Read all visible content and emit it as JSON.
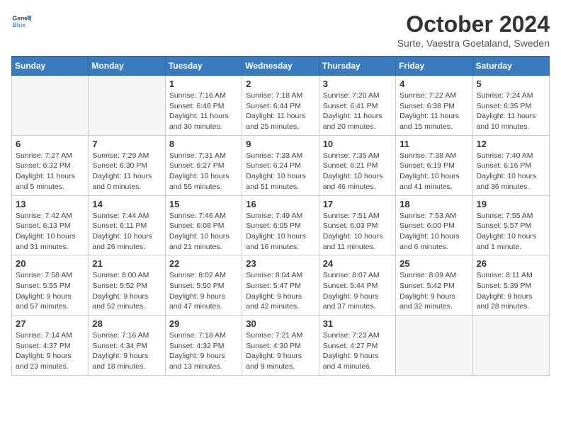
{
  "header": {
    "logo_line1": "General",
    "logo_line2": "Blue",
    "month": "October 2024",
    "location": "Surte, Vaestra Goetaland, Sweden"
  },
  "days_of_week": [
    "Sunday",
    "Monday",
    "Tuesday",
    "Wednesday",
    "Thursday",
    "Friday",
    "Saturday"
  ],
  "weeks": [
    [
      {
        "day": "",
        "info": ""
      },
      {
        "day": "",
        "info": ""
      },
      {
        "day": "1",
        "info": "Sunrise: 7:16 AM\nSunset: 6:46 PM\nDaylight: 11 hours and 30 minutes."
      },
      {
        "day": "2",
        "info": "Sunrise: 7:18 AM\nSunset: 6:44 PM\nDaylight: 11 hours and 25 minutes."
      },
      {
        "day": "3",
        "info": "Sunrise: 7:20 AM\nSunset: 6:41 PM\nDaylight: 11 hours and 20 minutes."
      },
      {
        "day": "4",
        "info": "Sunrise: 7:22 AM\nSunset: 6:38 PM\nDaylight: 11 hours and 15 minutes."
      },
      {
        "day": "5",
        "info": "Sunrise: 7:24 AM\nSunset: 6:35 PM\nDaylight: 11 hours and 10 minutes."
      }
    ],
    [
      {
        "day": "6",
        "info": "Sunrise: 7:27 AM\nSunset: 6:32 PM\nDaylight: 11 hours and 5 minutes."
      },
      {
        "day": "7",
        "info": "Sunrise: 7:29 AM\nSunset: 6:30 PM\nDaylight: 11 hours and 0 minutes."
      },
      {
        "day": "8",
        "info": "Sunrise: 7:31 AM\nSunset: 6:27 PM\nDaylight: 10 hours and 55 minutes."
      },
      {
        "day": "9",
        "info": "Sunrise: 7:33 AM\nSunset: 6:24 PM\nDaylight: 10 hours and 51 minutes."
      },
      {
        "day": "10",
        "info": "Sunrise: 7:35 AM\nSunset: 6:21 PM\nDaylight: 10 hours and 46 minutes."
      },
      {
        "day": "11",
        "info": "Sunrise: 7:38 AM\nSunset: 6:19 PM\nDaylight: 10 hours and 41 minutes."
      },
      {
        "day": "12",
        "info": "Sunrise: 7:40 AM\nSunset: 6:16 PM\nDaylight: 10 hours and 36 minutes."
      }
    ],
    [
      {
        "day": "13",
        "info": "Sunrise: 7:42 AM\nSunset: 6:13 PM\nDaylight: 10 hours and 31 minutes."
      },
      {
        "day": "14",
        "info": "Sunrise: 7:44 AM\nSunset: 6:11 PM\nDaylight: 10 hours and 26 minutes."
      },
      {
        "day": "15",
        "info": "Sunrise: 7:46 AM\nSunset: 6:08 PM\nDaylight: 10 hours and 21 minutes."
      },
      {
        "day": "16",
        "info": "Sunrise: 7:49 AM\nSunset: 6:05 PM\nDaylight: 10 hours and 16 minutes."
      },
      {
        "day": "17",
        "info": "Sunrise: 7:51 AM\nSunset: 6:03 PM\nDaylight: 10 hours and 11 minutes."
      },
      {
        "day": "18",
        "info": "Sunrise: 7:53 AM\nSunset: 6:00 PM\nDaylight: 10 hours and 6 minutes."
      },
      {
        "day": "19",
        "info": "Sunrise: 7:55 AM\nSunset: 5:57 PM\nDaylight: 10 hours and 1 minute."
      }
    ],
    [
      {
        "day": "20",
        "info": "Sunrise: 7:58 AM\nSunset: 5:55 PM\nDaylight: 9 hours and 57 minutes."
      },
      {
        "day": "21",
        "info": "Sunrise: 8:00 AM\nSunset: 5:52 PM\nDaylight: 9 hours and 52 minutes."
      },
      {
        "day": "22",
        "info": "Sunrise: 8:02 AM\nSunset: 5:50 PM\nDaylight: 9 hours and 47 minutes."
      },
      {
        "day": "23",
        "info": "Sunrise: 8:04 AM\nSunset: 5:47 PM\nDaylight: 9 hours and 42 minutes."
      },
      {
        "day": "24",
        "info": "Sunrise: 8:07 AM\nSunset: 5:44 PM\nDaylight: 9 hours and 37 minutes."
      },
      {
        "day": "25",
        "info": "Sunrise: 8:09 AM\nSunset: 5:42 PM\nDaylight: 9 hours and 32 minutes."
      },
      {
        "day": "26",
        "info": "Sunrise: 8:11 AM\nSunset: 5:39 PM\nDaylight: 9 hours and 28 minutes."
      }
    ],
    [
      {
        "day": "27",
        "info": "Sunrise: 7:14 AM\nSunset: 4:37 PM\nDaylight: 9 hours and 23 minutes."
      },
      {
        "day": "28",
        "info": "Sunrise: 7:16 AM\nSunset: 4:34 PM\nDaylight: 9 hours and 18 minutes."
      },
      {
        "day": "29",
        "info": "Sunrise: 7:18 AM\nSunset: 4:32 PM\nDaylight: 9 hours and 13 minutes."
      },
      {
        "day": "30",
        "info": "Sunrise: 7:21 AM\nSunset: 4:30 PM\nDaylight: 9 hours and 9 minutes."
      },
      {
        "day": "31",
        "info": "Sunrise: 7:23 AM\nSunset: 4:27 PM\nDaylight: 9 hours and 4 minutes."
      },
      {
        "day": "",
        "info": ""
      },
      {
        "day": "",
        "info": ""
      }
    ]
  ]
}
